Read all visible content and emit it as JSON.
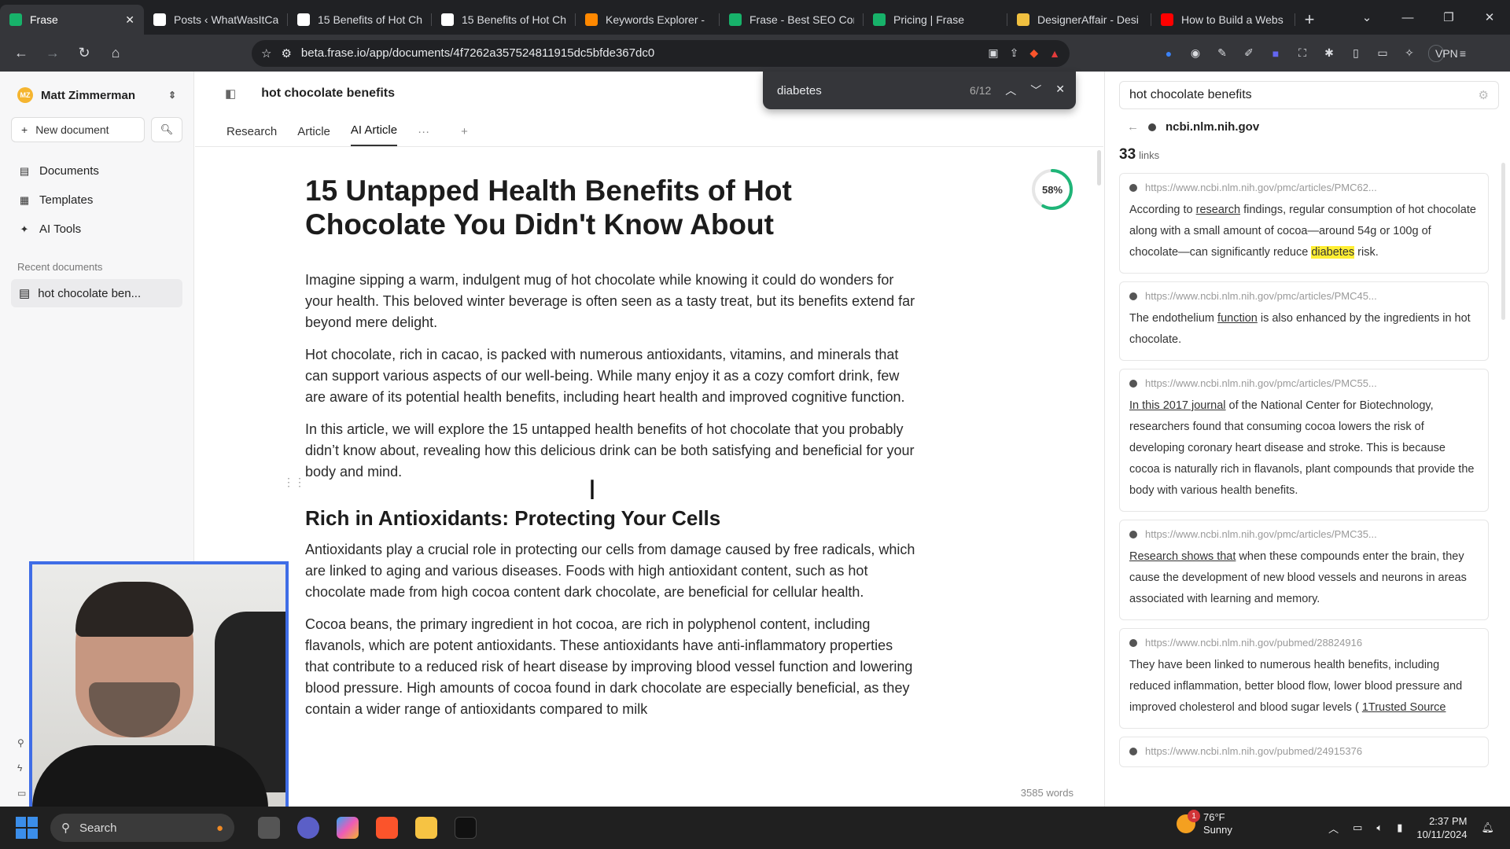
{
  "browser": {
    "tabs": [
      {
        "title": "Frase",
        "favicon": "frase-icon",
        "fav_color": "#17b26a",
        "active": true
      },
      {
        "title": "Posts ‹ WhatWasItCal",
        "favicon": "wordpress-icon",
        "fav_color": "#ffffff"
      },
      {
        "title": "15 Benefits of Hot Ch",
        "favicon": "page-icon",
        "fav_color": "#ffffff"
      },
      {
        "title": "15 Benefits of Hot Ch",
        "favicon": "page-icon",
        "fav_color": "#ffffff"
      },
      {
        "title": "Keywords Explorer -",
        "favicon": "ahrefs-icon",
        "fav_color": "#ff8800"
      },
      {
        "title": "Frase - Best SEO Con",
        "favicon": "frase-icon",
        "fav_color": "#17b26a"
      },
      {
        "title": "Pricing | Frase",
        "favicon": "frase-icon",
        "fav_color": "#17b26a"
      },
      {
        "title": "DesignerAffair - Desi",
        "favicon": "designer-icon",
        "fav_color": "#f0c040"
      },
      {
        "title": "How to Build a Webs",
        "favicon": "youtube-icon",
        "fav_color": "#ff0000"
      }
    ],
    "url": "beta.frase.io/app/documents/4f7262a357524811915dc5bfde367dc0",
    "vpn_label": "VPN"
  },
  "findbar": {
    "query": "diabetes",
    "count": "6/12"
  },
  "sidebar": {
    "user_name": "Matt Zimmerman",
    "avatar_initials": "MZ",
    "new_document": "New document",
    "nav": [
      {
        "label": "Documents",
        "icon": "document-icon"
      },
      {
        "label": "Templates",
        "icon": "grid-icon"
      },
      {
        "label": "AI Tools",
        "icon": "sparkle-icon"
      }
    ],
    "recent_label": "Recent documents",
    "recent_items": [
      "hot chocolate ben..."
    ]
  },
  "document": {
    "title": "hot chocolate benefits",
    "tabs": [
      "Research",
      "Article",
      "AI Article"
    ],
    "active_tab": "AI Article",
    "score_label": "58%",
    "score_value": 0.58,
    "word_count": "3585 words",
    "heading": "15 Untapped Health Benefits of Hot Chocolate You Didn't Know About",
    "paragraphs": [
      "Imagine sipping a warm, indulgent mug of hot chocolate while knowing it could do wonders for your health. This beloved winter beverage is often seen as a tasty treat, but its benefits extend far beyond mere delight.",
      "Hot chocolate, rich in cacao, is packed with numerous antioxidants, vitamins, and minerals that can support various aspects of our well-being. While many enjoy it as a cozy comfort drink, few are aware of its potential health benefits, including heart health and improved cognitive function.",
      "In this article, we will explore the 15 untapped health benefits of hot chocolate that you probably didn’t know about, revealing how this delicious drink can be both satisfying and beneficial for your body and mind."
    ],
    "subheading": "Rich in Antioxidants: Protecting Your Cells",
    "paragraphs2": [
      "Antioxidants play a crucial role in protecting our cells from damage caused by free radicals, which are linked to aging and various diseases. Foods with high antioxidant content, such as hot chocolate made from high cocoa content dark chocolate, are beneficial for cellular health.",
      "Cocoa beans, the primary ingredient in hot cocoa, are rich in polyphenol content, including flavanols, which are potent antioxidants. These antioxidants have anti-inflammatory properties that contribute to a reduced risk of heart disease by improving blood vessel function and lowering blood pressure. High amounts of cocoa found in dark chocolate are especially beneficial, as they contain a wider range of antioxidants compared to milk"
    ]
  },
  "research": {
    "query": "hot chocolate benefits",
    "source": "ncbi.nlm.nih.gov",
    "links_count": "33",
    "links_label": "links",
    "cards": [
      {
        "url": "https://www.ncbi.nlm.nih.gov/pmc/articles/PMC62...",
        "pre": "According to ",
        "link": "research",
        "post": " findings, regular consumption of hot chocolate along with a small amount of cocoa—around 54g or 100g of chocolate—can significantly reduce ",
        "highlight": "diabetes",
        "tail": " risk."
      },
      {
        "url": "https://www.ncbi.nlm.nih.gov/pmc/articles/PMC45...",
        "pre": "The endothelium ",
        "link": "function",
        "post": " is also enhanced by the ingredients in hot chocolate.",
        "highlight": "",
        "tail": ""
      },
      {
        "url": "https://www.ncbi.nlm.nih.gov/pmc/articles/PMC55...",
        "pre": "",
        "link": "In this 2017 journal",
        "post": " of the National Center for Biotechnology, researchers found that consuming cocoa lowers the risk of developing coronary heart disease and stroke. This is because cocoa is naturally rich in flavanols, plant compounds that provide the body with various health benefits.",
        "highlight": "",
        "tail": ""
      },
      {
        "url": "https://www.ncbi.nlm.nih.gov/pmc/articles/PMC35...",
        "pre": "",
        "link": "Research shows that",
        "post": " when these compounds enter the brain, they cause the development of new blood vessels and neurons in areas associated with learning and memory.",
        "highlight": "",
        "tail": ""
      },
      {
        "url": "https://www.ncbi.nlm.nih.gov/pubmed/28824916",
        "pre": "They have been linked to numerous health benefits, including reduced inflammation, better blood flow, lower blood pressure and improved cholesterol and blood sugar levels ( ",
        "link": "1Trusted Source",
        "post": "",
        "highlight": "",
        "tail": ""
      },
      {
        "url": "https://www.ncbi.nlm.nih.gov/pubmed/24915376",
        "pre": "",
        "link": "",
        "post": "",
        "highlight": "",
        "tail": ""
      }
    ]
  },
  "taskbar": {
    "search_label": "Search",
    "weather_temp": "76°F",
    "weather_desc": "Sunny",
    "weather_badge": "1",
    "time": "2:37 PM",
    "date": "10/11/2024"
  }
}
